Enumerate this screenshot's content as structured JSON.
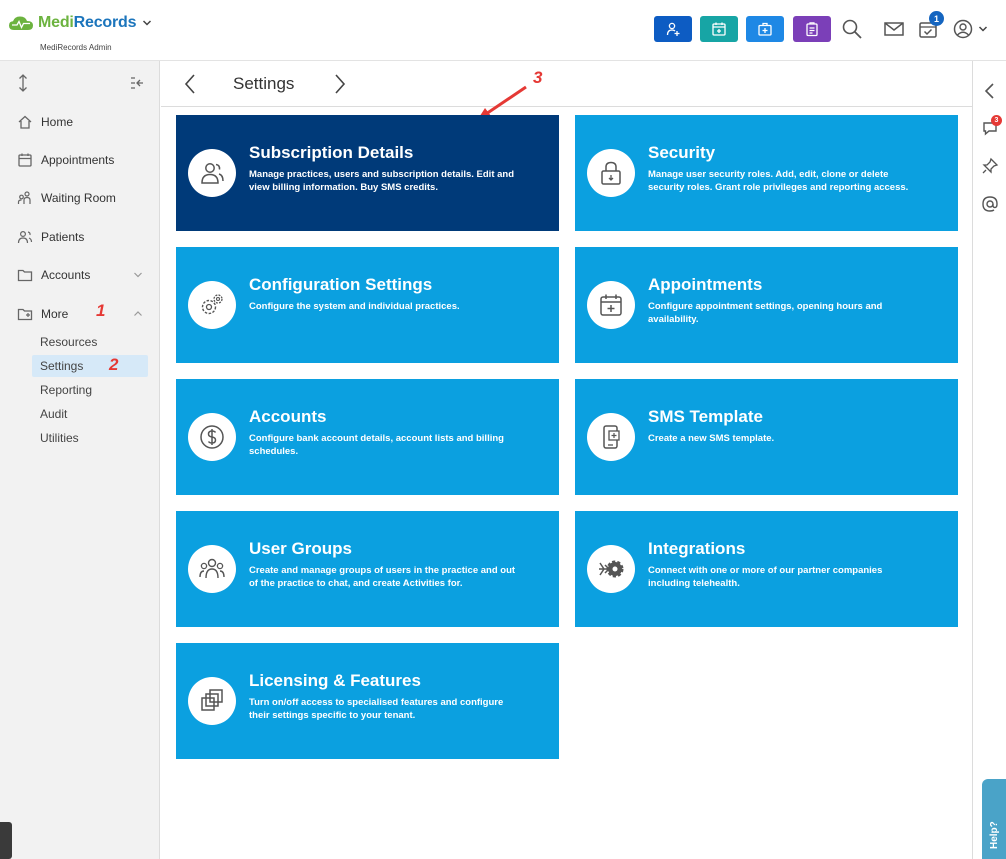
{
  "header": {
    "brand_part1": "Medi",
    "brand_part2": "Records",
    "subtitle": "MediRecords Admin",
    "notification_count": "1"
  },
  "quick_actions": [
    {
      "name": "add-patient",
      "color": "#0d5cc3"
    },
    {
      "name": "add-appointment",
      "color": "#17a5a5"
    },
    {
      "name": "add-clinical",
      "color": "#1e88e5"
    },
    {
      "name": "add-task",
      "color": "#7b3fb8"
    }
  ],
  "sidebar": {
    "items": [
      {
        "label": "Home"
      },
      {
        "label": "Appointments"
      },
      {
        "label": "Waiting Room"
      },
      {
        "label": "Patients"
      },
      {
        "label": "Accounts"
      },
      {
        "label": "More"
      }
    ],
    "more_submenu": [
      {
        "label": "Resources"
      },
      {
        "label": "Settings"
      },
      {
        "label": "Reporting"
      },
      {
        "label": "Audit"
      },
      {
        "label": "Utilities"
      }
    ]
  },
  "annotations": [
    "1",
    "2",
    "3"
  ],
  "page": {
    "title": "Settings"
  },
  "cards": [
    {
      "title": "Subscription Details",
      "desc": "Manage practices, users and subscription details. Edit and view billing information. Buy SMS credits.",
      "icon": "users-icon"
    },
    {
      "title": "Security",
      "desc": "Manage user security roles. Add, edit, clone or delete security roles. Grant role privileges and reporting access.",
      "icon": "lock-icon"
    },
    {
      "title": "Configuration Settings",
      "desc": "Configure the system and individual practices.",
      "icon": "gears-icon"
    },
    {
      "title": "Appointments",
      "desc": "Configure appointment settings, opening hours and availability.",
      "icon": "calendar-icon"
    },
    {
      "title": "Accounts",
      "desc": "Configure bank account details, account lists and billing schedules.",
      "icon": "dollar-icon"
    },
    {
      "title": "SMS Template",
      "desc": "Create a new SMS template.",
      "icon": "sms-icon"
    },
    {
      "title": "User Groups",
      "desc": "Create and manage groups of users in the practice and out of the practice to chat, and create Activities for.",
      "icon": "group-icon"
    },
    {
      "title": "Integrations",
      "desc": "Connect with one or more of our partner companies including telehealth.",
      "icon": "integration-icon"
    },
    {
      "title": "Licensing & Features",
      "desc": "Turn on/off access to specialised features and configure their settings specific to your tenant.",
      "icon": "licensing-icon"
    }
  ],
  "right_rail": {
    "chat_badge": "3",
    "help_label": "Help?"
  }
}
